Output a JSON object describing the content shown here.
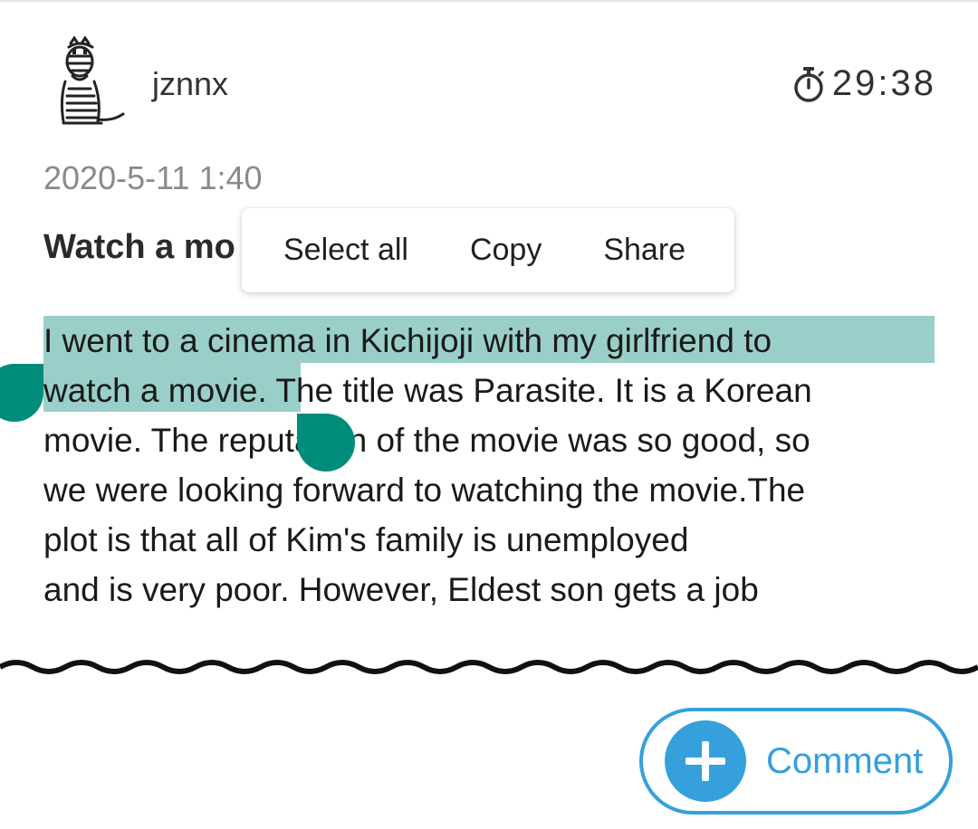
{
  "post": {
    "username": "jznnx",
    "timer": "29:38",
    "date": "2020-5-11 1:40",
    "title_visible": "Watch a mo",
    "body_lines": [
      "I went to a cinema in Kichijoji with my girlfriend to",
      "watch a movie. The title was Parasite. It is a Korean",
      "movie. The reputation of the movie was so good, so",
      "we were looking forward to watching the movie.The",
      "plot is that all of Kim's family is unemployed",
      "and is very poor. However, Eldest son gets a job"
    ],
    "selected_text": "I went to a cinema in Kichijoji with my girlfriend to watch a movie."
  },
  "context_menu": {
    "items": [
      "Select all",
      "Copy",
      "Share"
    ]
  },
  "comment_button": {
    "label": "Comment"
  },
  "colors": {
    "selection": "#99cfc8",
    "handle": "#008c7a",
    "accent": "#35a0dc"
  },
  "icons": {
    "avatar": "zebra-avatar",
    "timer": "stopwatch-icon",
    "comment": "plus-icon"
  }
}
